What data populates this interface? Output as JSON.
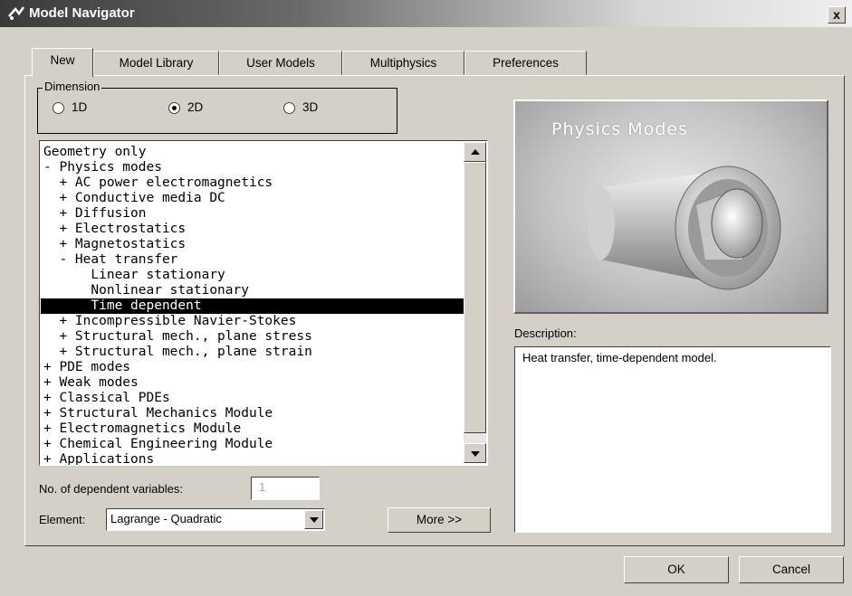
{
  "window": {
    "title": "Model Navigator",
    "close_glyph": "x"
  },
  "tabs": [
    {
      "label": "New",
      "active": true
    },
    {
      "label": "Model Library",
      "active": false
    },
    {
      "label": "User Models",
      "active": false
    },
    {
      "label": "Multiphysics",
      "active": false
    },
    {
      "label": "Preferences",
      "active": false
    }
  ],
  "dimension": {
    "legend": "Dimension",
    "options": [
      {
        "label": "1D",
        "selected": false
      },
      {
        "label": "2D",
        "selected": true
      },
      {
        "label": "3D",
        "selected": false
      }
    ]
  },
  "tree": {
    "items": [
      "Geometry only",
      "- Physics modes",
      "  + AC power electromagnetics",
      "  + Conductive media DC",
      "  + Diffusion",
      "  + Electrostatics",
      "  + Magnetostatics",
      "  - Heat transfer",
      "      Linear stationary",
      "      Nonlinear stationary",
      "      Time dependent",
      "  + Incompressible Navier-Stokes",
      "  + Structural mech., plane stress",
      "  + Structural mech., plane strain",
      "+ PDE modes",
      "+ Weak modes",
      "+ Classical PDEs",
      "+ Structural Mechanics Module",
      "+ Electromagnetics Module",
      "+ Chemical Engineering Module",
      "+ Applications"
    ],
    "selected_index": 10
  },
  "dependent_variables": {
    "label": "No. of dependent variables:",
    "value": "1"
  },
  "element": {
    "label": "Element:",
    "value": "Lagrange - Quadratic"
  },
  "more_button": "More >>",
  "preview": {
    "title": "Physics Modes"
  },
  "description": {
    "label": "Description:",
    "text": "Heat transfer, time-dependent model."
  },
  "ok_button": "OK",
  "cancel_button": "Cancel"
}
